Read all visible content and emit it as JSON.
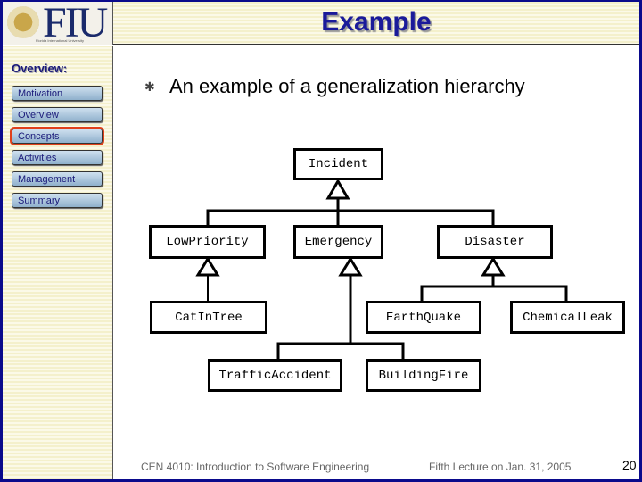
{
  "header": {
    "logo_text": "FIU",
    "logo_subtitle": "Florida International University",
    "title": "Example"
  },
  "sidebar": {
    "heading": "Overview:",
    "items": [
      {
        "label": "Motivation"
      },
      {
        "label": "Overview"
      },
      {
        "label": "Concepts",
        "selected": true
      },
      {
        "label": "Activities"
      },
      {
        "label": "Management"
      },
      {
        "label": "Summary"
      }
    ]
  },
  "main": {
    "bullet_icon": "asterisk-bullet",
    "heading": "An example of a generalization hierarchy"
  },
  "diagram": {
    "classes": {
      "incident": "Incident",
      "lowpriority": "LowPriority",
      "emergency": "Emergency",
      "disaster": "Disaster",
      "catintree": "CatInTree",
      "earthquake": "EarthQuake",
      "chemicalleak": "ChemicalLeak",
      "trafficaccident": "TrafficAccident",
      "buildingfire": "BuildingFire"
    }
  },
  "footer": {
    "course": "CEN 4010: Introduction to Software Engineering",
    "lecture": "Fifth Lecture on Jan. 31, 2005",
    "page": "20"
  },
  "colors": {
    "frame": "#0a0a8c",
    "title": "#1a1a9a",
    "selected_outline": "#e0401a"
  }
}
